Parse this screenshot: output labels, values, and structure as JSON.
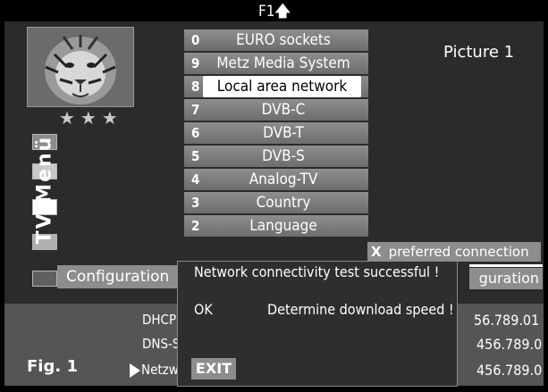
{
  "top_marker": {
    "label": "F1",
    "arrow": "arrow-up-icon"
  },
  "thumbnail": {
    "stars": "★★★",
    "subject": "tiger-image"
  },
  "side_label": "TV-Menü",
  "menu": [
    {
      "num": "0",
      "label": "EURO sockets",
      "selected": false
    },
    {
      "num": "9",
      "label": "Metz Media System",
      "selected": false
    },
    {
      "num": "8",
      "label": "Local area network",
      "selected": true
    },
    {
      "num": "7",
      "label": "DVB-C",
      "selected": false
    },
    {
      "num": "6",
      "label": "DVB-T",
      "selected": false
    },
    {
      "num": "5",
      "label": "DVB-S",
      "selected": false
    },
    {
      "num": "4",
      "label": "Analog-TV",
      "selected": false
    },
    {
      "num": "3",
      "label": "Country",
      "selected": false
    },
    {
      "num": "2",
      "label": "Language",
      "selected": false
    }
  ],
  "right_panel": {
    "picture_label": "Picture 1",
    "preferred_x": "X",
    "preferred_label": "preferred connection",
    "configuration_right": "guration"
  },
  "configuration_left": "Configuration",
  "bottom": {
    "fig_label": "Fig. 1",
    "row_labels": [
      "DHCP",
      "DNS-S",
      "Netzw"
    ],
    "row_values": [
      "56.789.01",
      "456.789.0",
      "456.789.0"
    ]
  },
  "dialog": {
    "message": "Network connectivity test successful !",
    "ok_label": "OK",
    "download_label": "Determine download speed !",
    "exit_label": "EXIT"
  },
  "colors": {
    "menu_bg": "#7d7d7d",
    "highlight": "#ffffff",
    "screen_bg": "#2b2b2b"
  }
}
